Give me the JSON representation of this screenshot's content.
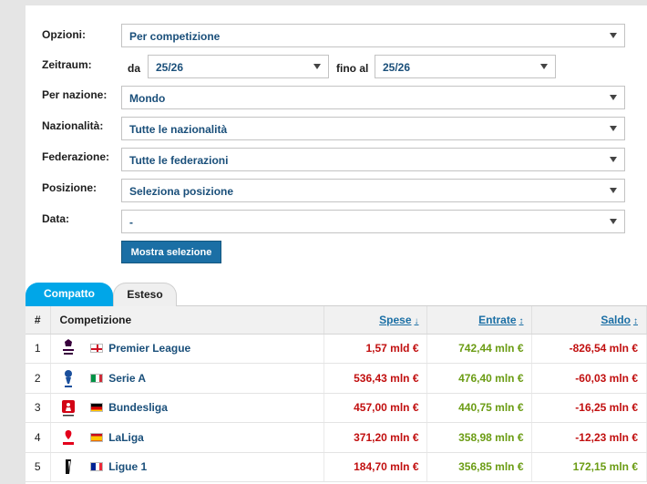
{
  "filters": {
    "opzioni": {
      "label": "Opzioni:",
      "value": "Per competizione"
    },
    "zeitraum": {
      "label": "Zeitraum:",
      "da_label": "da",
      "da_value": "25/26",
      "fino_label": "fino al",
      "fino_value": "25/26"
    },
    "nazione": {
      "label": "Per nazione:",
      "value": "Mondo"
    },
    "nazionalita": {
      "label": "Nazionalità:",
      "value": "Tutte le nazionalità"
    },
    "federazione": {
      "label": "Federazione:",
      "value": "Tutte le federazioni"
    },
    "posizione": {
      "label": "Posizione:",
      "value": "Seleziona posizione"
    },
    "data": {
      "label": "Data:",
      "value": "-"
    },
    "submit_label": "Mostra selezione"
  },
  "tabs": {
    "compatto": "Compatto",
    "esteso": "Esteso"
  },
  "table": {
    "headers": {
      "num": "#",
      "competizione": "Competizione",
      "spese": "Spese",
      "entrate": "Entrate",
      "saldo": "Saldo"
    },
    "rows": [
      {
        "num": "1",
        "name": "Premier League",
        "flag": "england",
        "spese": "1,57 mld €",
        "entrate": "742,44 mln €",
        "saldo": "-826,54 mln €",
        "saldo_sign": "neg"
      },
      {
        "num": "2",
        "name": "Serie A",
        "flag": "italy",
        "spese": "536,43 mln €",
        "entrate": "476,40 mln €",
        "saldo": "-60,03 mln €",
        "saldo_sign": "neg"
      },
      {
        "num": "3",
        "name": "Bundesliga",
        "flag": "germany",
        "spese": "457,00 mln €",
        "entrate": "440,75 mln €",
        "saldo": "-16,25 mln €",
        "saldo_sign": "neg"
      },
      {
        "num": "4",
        "name": "LaLiga",
        "flag": "spain",
        "spese": "371,20 mln €",
        "entrate": "358,98 mln €",
        "saldo": "-12,23 mln €",
        "saldo_sign": "neg"
      },
      {
        "num": "5",
        "name": "Ligue 1",
        "flag": "france",
        "spese": "184,70 mln €",
        "entrate": "356,85 mln €",
        "saldo": "172,15 mln €",
        "saldo_sign": "pos"
      }
    ]
  },
  "colors": {
    "accent": "#1b6fa5",
    "tab_active": "#00a6e8",
    "negative": "#c10f0f",
    "positive": "#6b9c14"
  }
}
